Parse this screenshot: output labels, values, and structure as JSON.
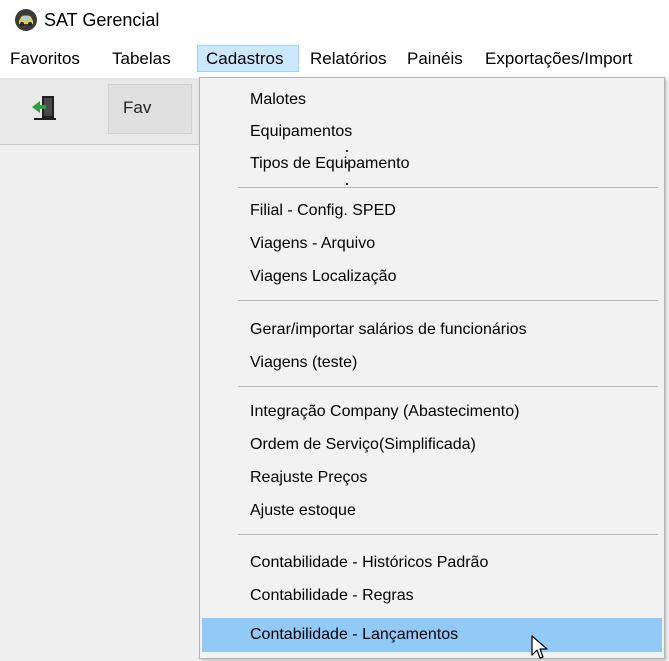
{
  "app": {
    "title": "SAT Gerencial",
    "icon": "car-app-icon"
  },
  "menubar": {
    "items": [
      {
        "label": "Favoritos"
      },
      {
        "label": "Tabelas"
      },
      {
        "label": "Cadastros",
        "active": true
      },
      {
        "label": "Relatórios"
      },
      {
        "label": "Painéis"
      },
      {
        "label": "Exportações/Import"
      }
    ]
  },
  "toolbar": {
    "exit_icon": "exit-door-icon",
    "fav_label": "Fav"
  },
  "dropdown": {
    "items": [
      {
        "label": "Malotes"
      },
      {
        "label": "Equipamentos"
      },
      {
        "label": "Tipos de Equipamento"
      },
      {
        "label": "Filial - Config. SPED"
      },
      {
        "label": "Viagens - Arquivo"
      },
      {
        "label": "Viagens Localização"
      },
      {
        "label": "Gerar/importar salários de funcionários"
      },
      {
        "label": "Viagens (teste)"
      },
      {
        "label": "Integração Company (Abastecimento)"
      },
      {
        "label": "Ordem de Serviço(Simplificada)"
      },
      {
        "label": "Reajuste Preços"
      },
      {
        "label": "Ajuste estoque"
      },
      {
        "label": "Contabilidade - Históricos Padrão"
      },
      {
        "label": "Contabilidade - Regras"
      },
      {
        "label": "Contabilidade - Lançamentos",
        "highlighted": true
      }
    ]
  },
  "colors": {
    "menu_active_bg": "#cce8ff",
    "highlight_bg": "#91c9f7",
    "dropdown_bg": "#f2f2f2"
  }
}
